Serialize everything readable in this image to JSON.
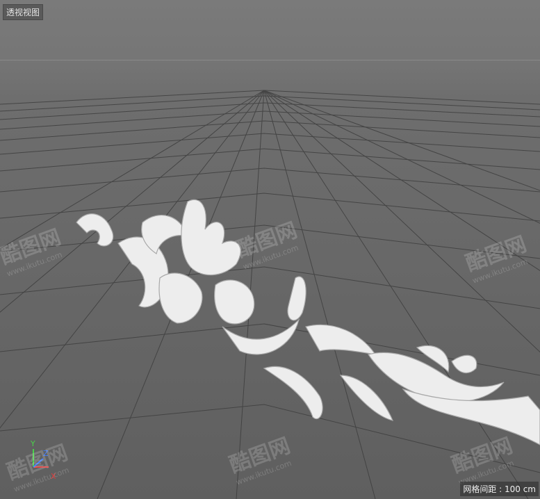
{
  "viewport": {
    "label": "透视视图",
    "grid_spacing": "网格间距 : 100 cm",
    "watermark": {
      "brand": "酷图网",
      "url": "www.ikutu.com"
    },
    "axis_gizmo": {
      "x": "X",
      "y": "Y",
      "z": "Z"
    },
    "colors": {
      "axis_x": "#e03b3b",
      "axis_y": "#4bd04b",
      "axis_z": "#3f7cff",
      "model": "#efefef"
    }
  }
}
